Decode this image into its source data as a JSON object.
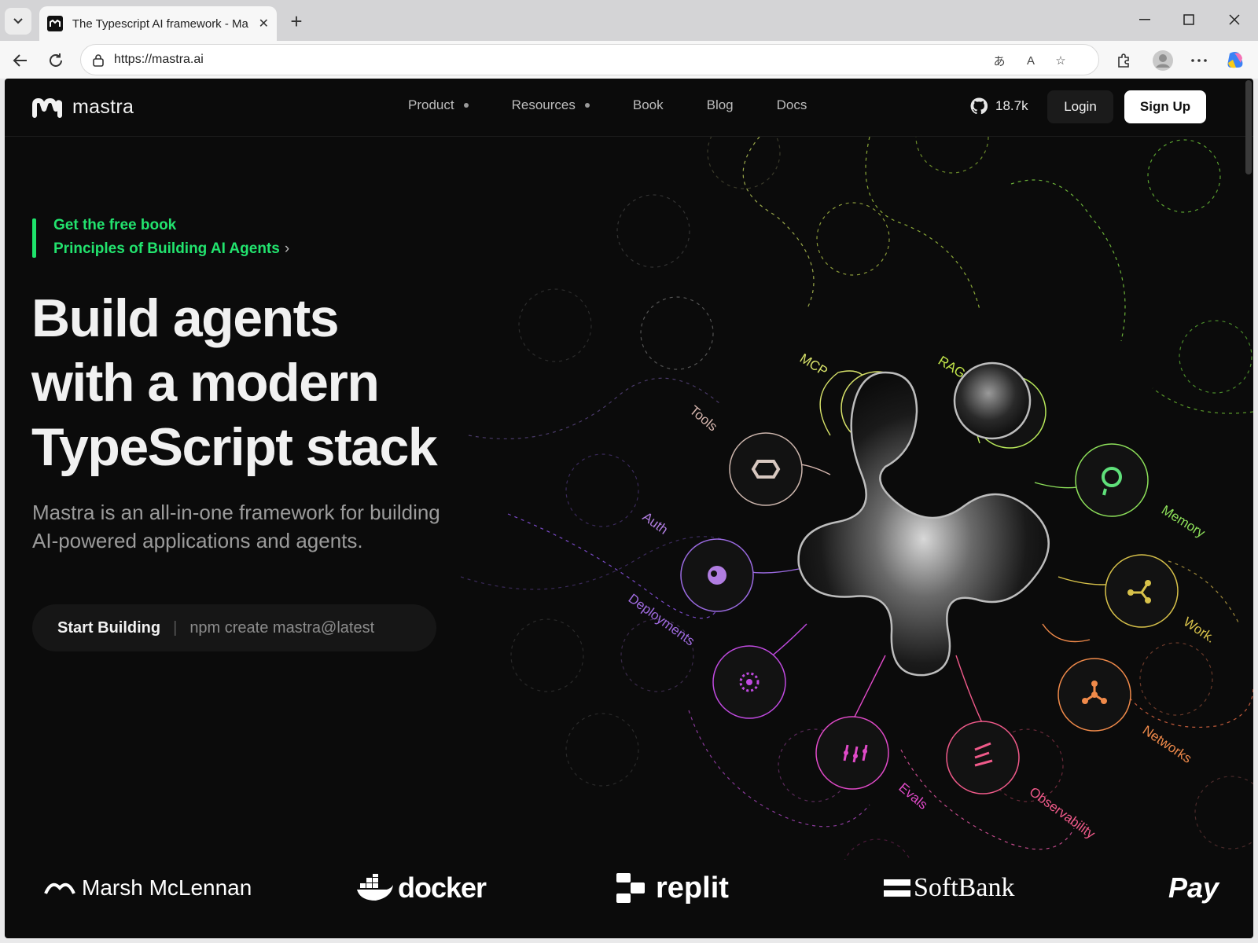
{
  "browser": {
    "tab_title": "The Typescript AI framework - Ma",
    "url": "https://mastra.ai"
  },
  "site": {
    "logo_text": "mastra",
    "nav": [
      {
        "label": "Product",
        "has_menu": true
      },
      {
        "label": "Resources",
        "has_menu": true
      },
      {
        "label": "Book",
        "has_menu": false
      },
      {
        "label": "Blog",
        "has_menu": false
      },
      {
        "label": "Docs",
        "has_menu": false
      }
    ],
    "github_stars": "18.7k",
    "login_label": "Login",
    "signup_label": "Sign Up"
  },
  "hero": {
    "book_line1": "Get the free book",
    "book_line2": "Principles of Building AI Agents",
    "book_chevron": "›",
    "headline_line1": "Build agents",
    "headline_line2": "with a modern",
    "headline_line3": "TypeScript stack",
    "subtitle_line1": "Mastra is an all-in-one framework for building",
    "subtitle_line2": "AI-powered applications and agents.",
    "cta_label": "Start Building",
    "cta_separator": "|",
    "cta_command": "npm create mastra@latest"
  },
  "illustration": {
    "labels": [
      {
        "text": "MCP",
        "color": "#d8e36a"
      },
      {
        "text": "RAG",
        "color": "#c4e84a"
      },
      {
        "text": "Tools",
        "color": "#d8b8b0"
      },
      {
        "text": "Memory",
        "color": "#8de05a"
      },
      {
        "text": "Auth",
        "color": "#b07de0"
      },
      {
        "text": "Deployments",
        "color": "#a06be0"
      },
      {
        "text": "Work.",
        "color": "#d8c24a"
      },
      {
        "text": "Networks",
        "color": "#f08a4a"
      },
      {
        "text": "Evals",
        "color": "#e04ac8"
      },
      {
        "text": "Observability",
        "color": "#f05a8a"
      }
    ]
  },
  "customer_logos": [
    "Marsh McLennan",
    "docker",
    "replit",
    "SoftBank",
    "Pay"
  ],
  "colors": {
    "accent_green": "#22e36e",
    "page_bg": "#0b0b0b"
  }
}
